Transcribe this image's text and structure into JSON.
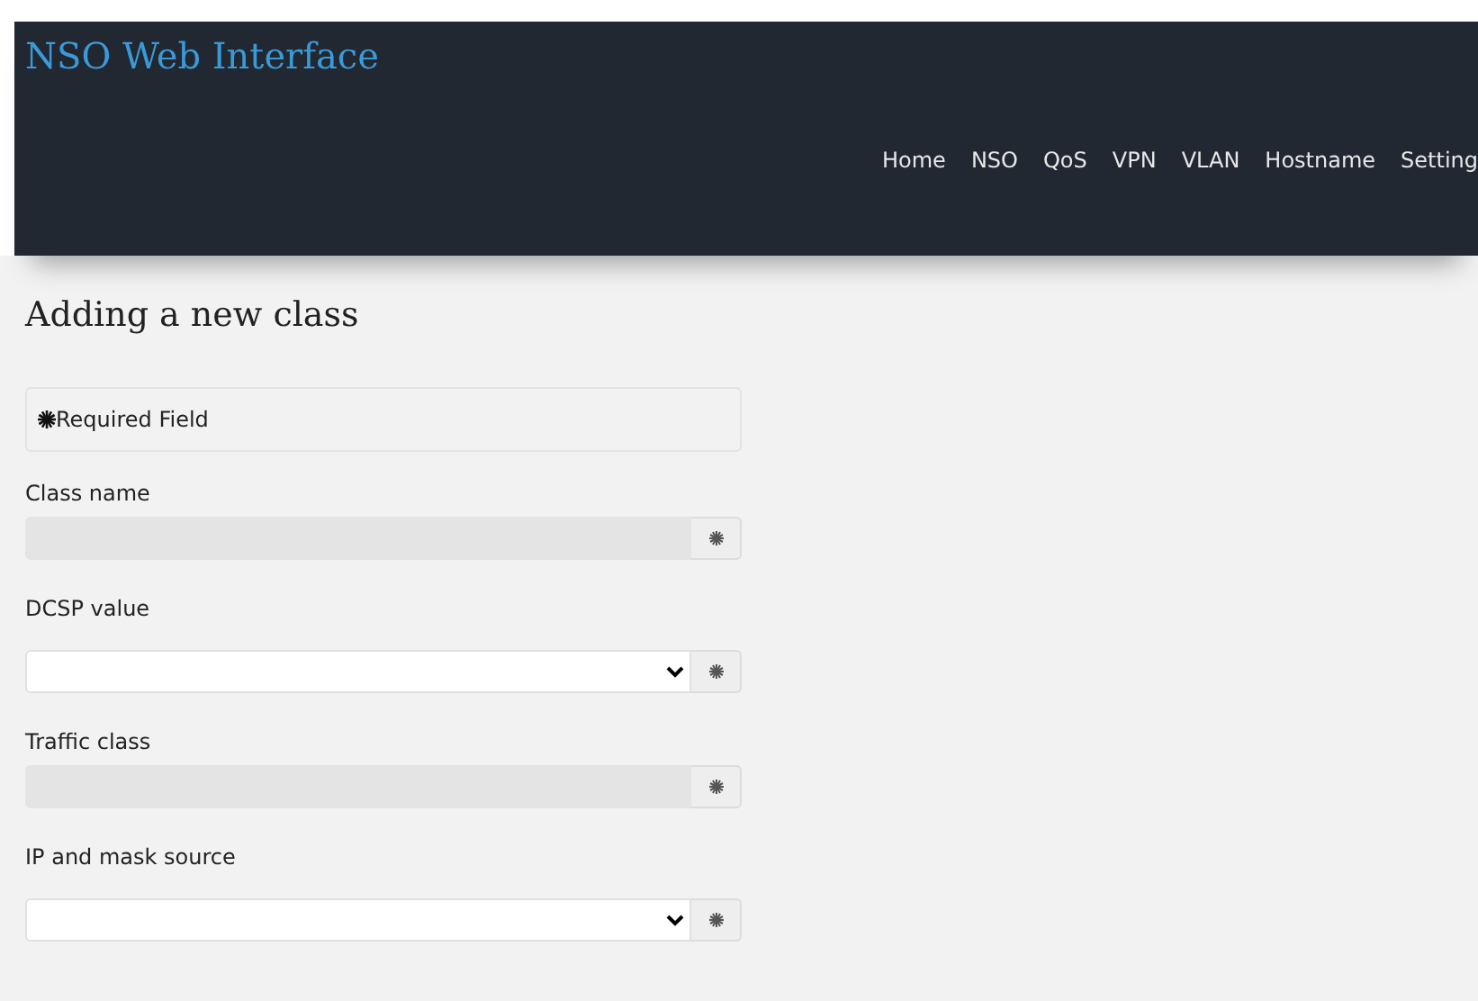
{
  "header": {
    "title": "NSO Web Interface",
    "nav": [
      {
        "label": "Home"
      },
      {
        "label": "NSO"
      },
      {
        "label": "QoS"
      },
      {
        "label": "VPN"
      },
      {
        "label": "VLAN"
      },
      {
        "label": "Hostname"
      },
      {
        "label": "Setting"
      }
    ]
  },
  "page_title": "Adding a new class",
  "required_note": "Required Field",
  "fields": [
    {
      "label": "Class name",
      "kind": "text",
      "disabled": true
    },
    {
      "label": "DCSP value",
      "kind": "select",
      "disabled": false
    },
    {
      "label": "Traffic class",
      "kind": "text",
      "disabled": true
    },
    {
      "label": "IP and mask source",
      "kind": "select",
      "disabled": false
    }
  ]
}
